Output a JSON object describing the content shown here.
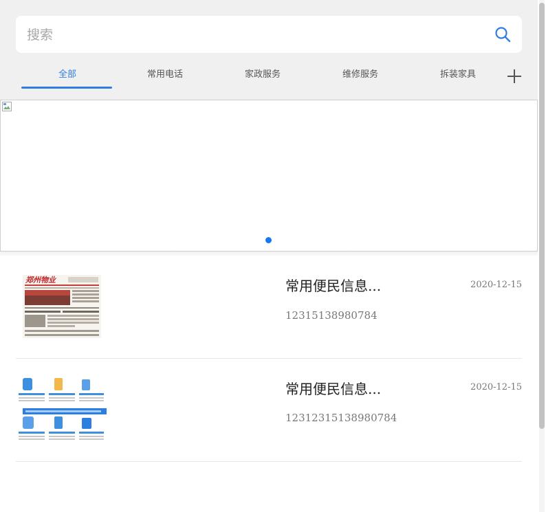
{
  "search": {
    "placeholder": "搜索"
  },
  "tabs": [
    {
      "label": "全部",
      "active": true
    },
    {
      "label": "常用电话",
      "active": false
    },
    {
      "label": "家政服务",
      "active": false
    },
    {
      "label": "维修服务",
      "active": false
    },
    {
      "label": "拆装家具",
      "active": false
    }
  ],
  "icons": {
    "search": "search-icon",
    "add": "plus-icon"
  },
  "colors": {
    "accent": "#2f7de1",
    "dot": "#1478f0"
  },
  "banner": {
    "slide_count": 1,
    "active_slide": 1
  },
  "list": [
    {
      "title": "常用便民信息...",
      "date": "2020-12-15",
      "phone": "12315138980784",
      "thumbnail": "newspaper-thumbnail"
    },
    {
      "title": "常用便民信息...",
      "date": "2020-12-15",
      "phone": "12312315138980784",
      "thumbnail": "infographic-thumbnail"
    }
  ]
}
